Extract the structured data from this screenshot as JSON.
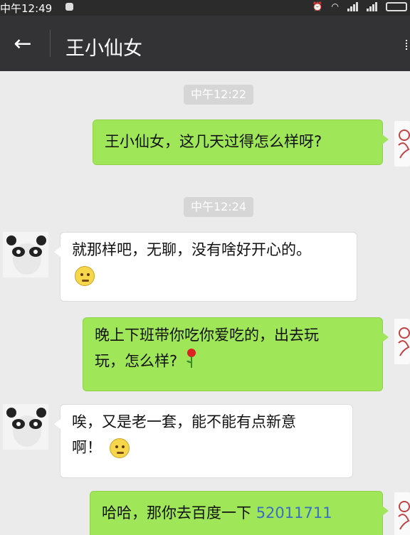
{
  "status_bar": {
    "time": "中午12:49"
  },
  "header": {
    "back_icon": "back-arrow-icon",
    "title": "王小仙女"
  },
  "colors": {
    "nav_bg": "#333335",
    "outgoing_bubble": "#9fe658",
    "incoming_bubble": "#ffffff",
    "chat_bg": "#ebebeb",
    "link_number": "#3a6fc0"
  },
  "messages": [
    {
      "type": "timestamp",
      "text": "中午12:22"
    },
    {
      "type": "outgoing",
      "text": "王小仙女，这几天过得怎么样呀?"
    },
    {
      "type": "timestamp",
      "text": "中午12:24"
    },
    {
      "type": "incoming",
      "line1": "就那样吧，无聊，没有啥好开心的。",
      "emoji": "awkward-smile-emoji"
    },
    {
      "type": "outgoing",
      "line1": "晚上下班带你吃你爱吃的，出去玩",
      "line2": "玩，怎么样?",
      "emoji": "rose-emoji"
    },
    {
      "type": "incoming",
      "line1": "唉，又是老一套，能不能有点新意",
      "line2": "啊！",
      "emoji": "sad-face-emoji"
    },
    {
      "type": "outgoing",
      "text": "哈哈，那你去百度一下 ",
      "number": "52011711"
    }
  ]
}
